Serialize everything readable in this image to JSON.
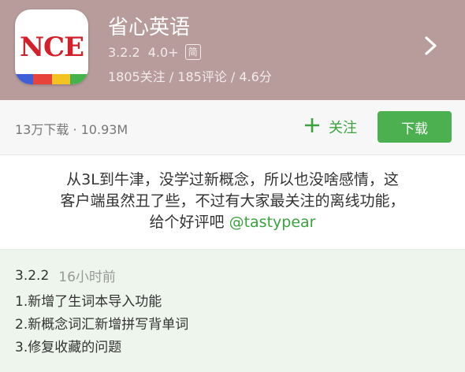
{
  "app": {
    "icon_text": "NCE",
    "icon_stripe_colors": [
      "#3f5fd8",
      "#e8433a",
      "#f3c324",
      "#45b24c"
    ],
    "name": "省心英语",
    "version": "3.2.2",
    "android_min": "4.0+",
    "lang_badge": "简",
    "follows": "1805关注",
    "reviews": "185评论",
    "score": "4.6分",
    "stats_separator": " / "
  },
  "actions": {
    "downloads": "13万下载 · 10.93M",
    "follow_icon": "plus-icon",
    "follow_label": "关注",
    "download_label": "下载"
  },
  "description": {
    "line1": "从3L到牛津，没学过新概念，所以也没啥感情，这",
    "line2": "客户端虽然丑了些，不过有大家最关注的离线功能，",
    "line3_text": "给个好评吧 ",
    "mention": "@tastypear"
  },
  "changelog": {
    "version": "3.2.2",
    "time": "16小时前",
    "items": [
      "1.新增了生词本导入功能",
      "2.新概念词汇新增拼写背单词",
      "3.修复收藏的问题"
    ]
  },
  "colors": {
    "header_bg": "#b89c9c",
    "accent_green": "#4caf50",
    "icon_red": "#d4202a"
  }
}
